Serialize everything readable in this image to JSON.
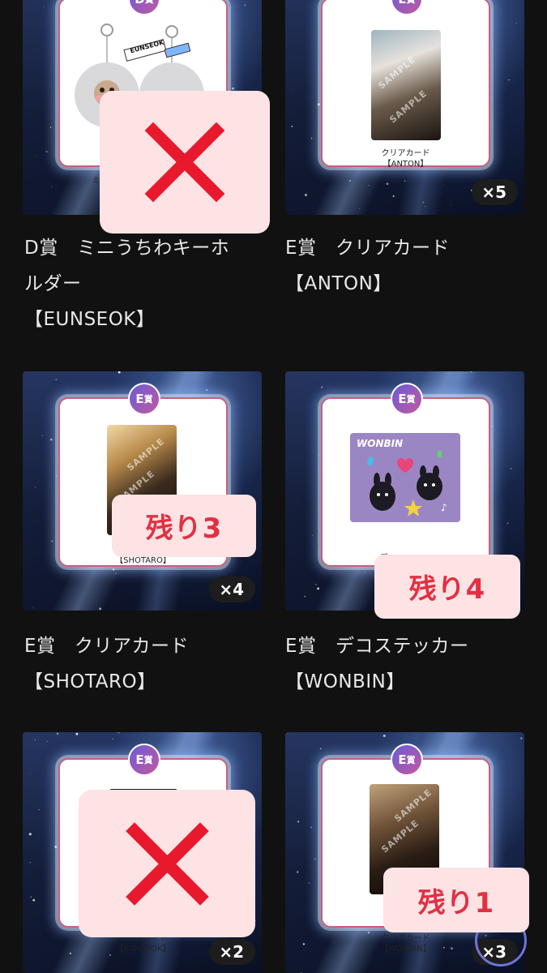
{
  "colors": {
    "background": "#111111",
    "cross": "#e8192c",
    "overlay": "#fde3e4",
    "remain_text": "#e23043"
  },
  "items": [
    {
      "badge_letter": "D",
      "badge_suffix": "賞",
      "image_label": "ミニ",
      "title_lines": [
        "D賞　ミニうちわキーホ",
        "ルダー",
        "【EUNSEOK】"
      ],
      "keychain_text": "EUNSEOK",
      "status": "sold-out"
    },
    {
      "badge_letter": "E",
      "badge_suffix": "賞",
      "image_label_lines": [
        "クリアカード",
        "【ANTON】"
      ],
      "quantity": "×5",
      "title_lines": [
        "E賞　クリアカード",
        "【ANTON】"
      ],
      "watermark": "SAMPLE"
    },
    {
      "badge_letter": "E",
      "badge_suffix": "賞",
      "image_label_lines": [
        "クリアカード",
        "【SHOTARO】"
      ],
      "quantity": "×4",
      "title_lines": [
        "E賞　クリアカード",
        "【SHOTARO】"
      ],
      "watermark": "SAMPLE",
      "remaining": "残り3"
    },
    {
      "badge_letter": "E",
      "badge_suffix": "賞",
      "image_label": "デ",
      "title_lines": [
        "E賞　デコステッカー",
        "【WONBIN】"
      ],
      "sticker_text": "WONBIN",
      "remaining": "残り4"
    },
    {
      "badge_letter": "E",
      "badge_suffix": "賞",
      "image_label_lines": [
        "クリアカード",
        "【EUNSEOK】"
      ],
      "quantity": "×2",
      "status": "sold-out"
    },
    {
      "badge_letter": "E",
      "badge_suffix": "賞",
      "image_label_lines": [
        "クリアカード",
        "【WONBIN】"
      ],
      "quantity": "×3",
      "watermark": "SAMPLE",
      "remaining": "残り1"
    }
  ]
}
